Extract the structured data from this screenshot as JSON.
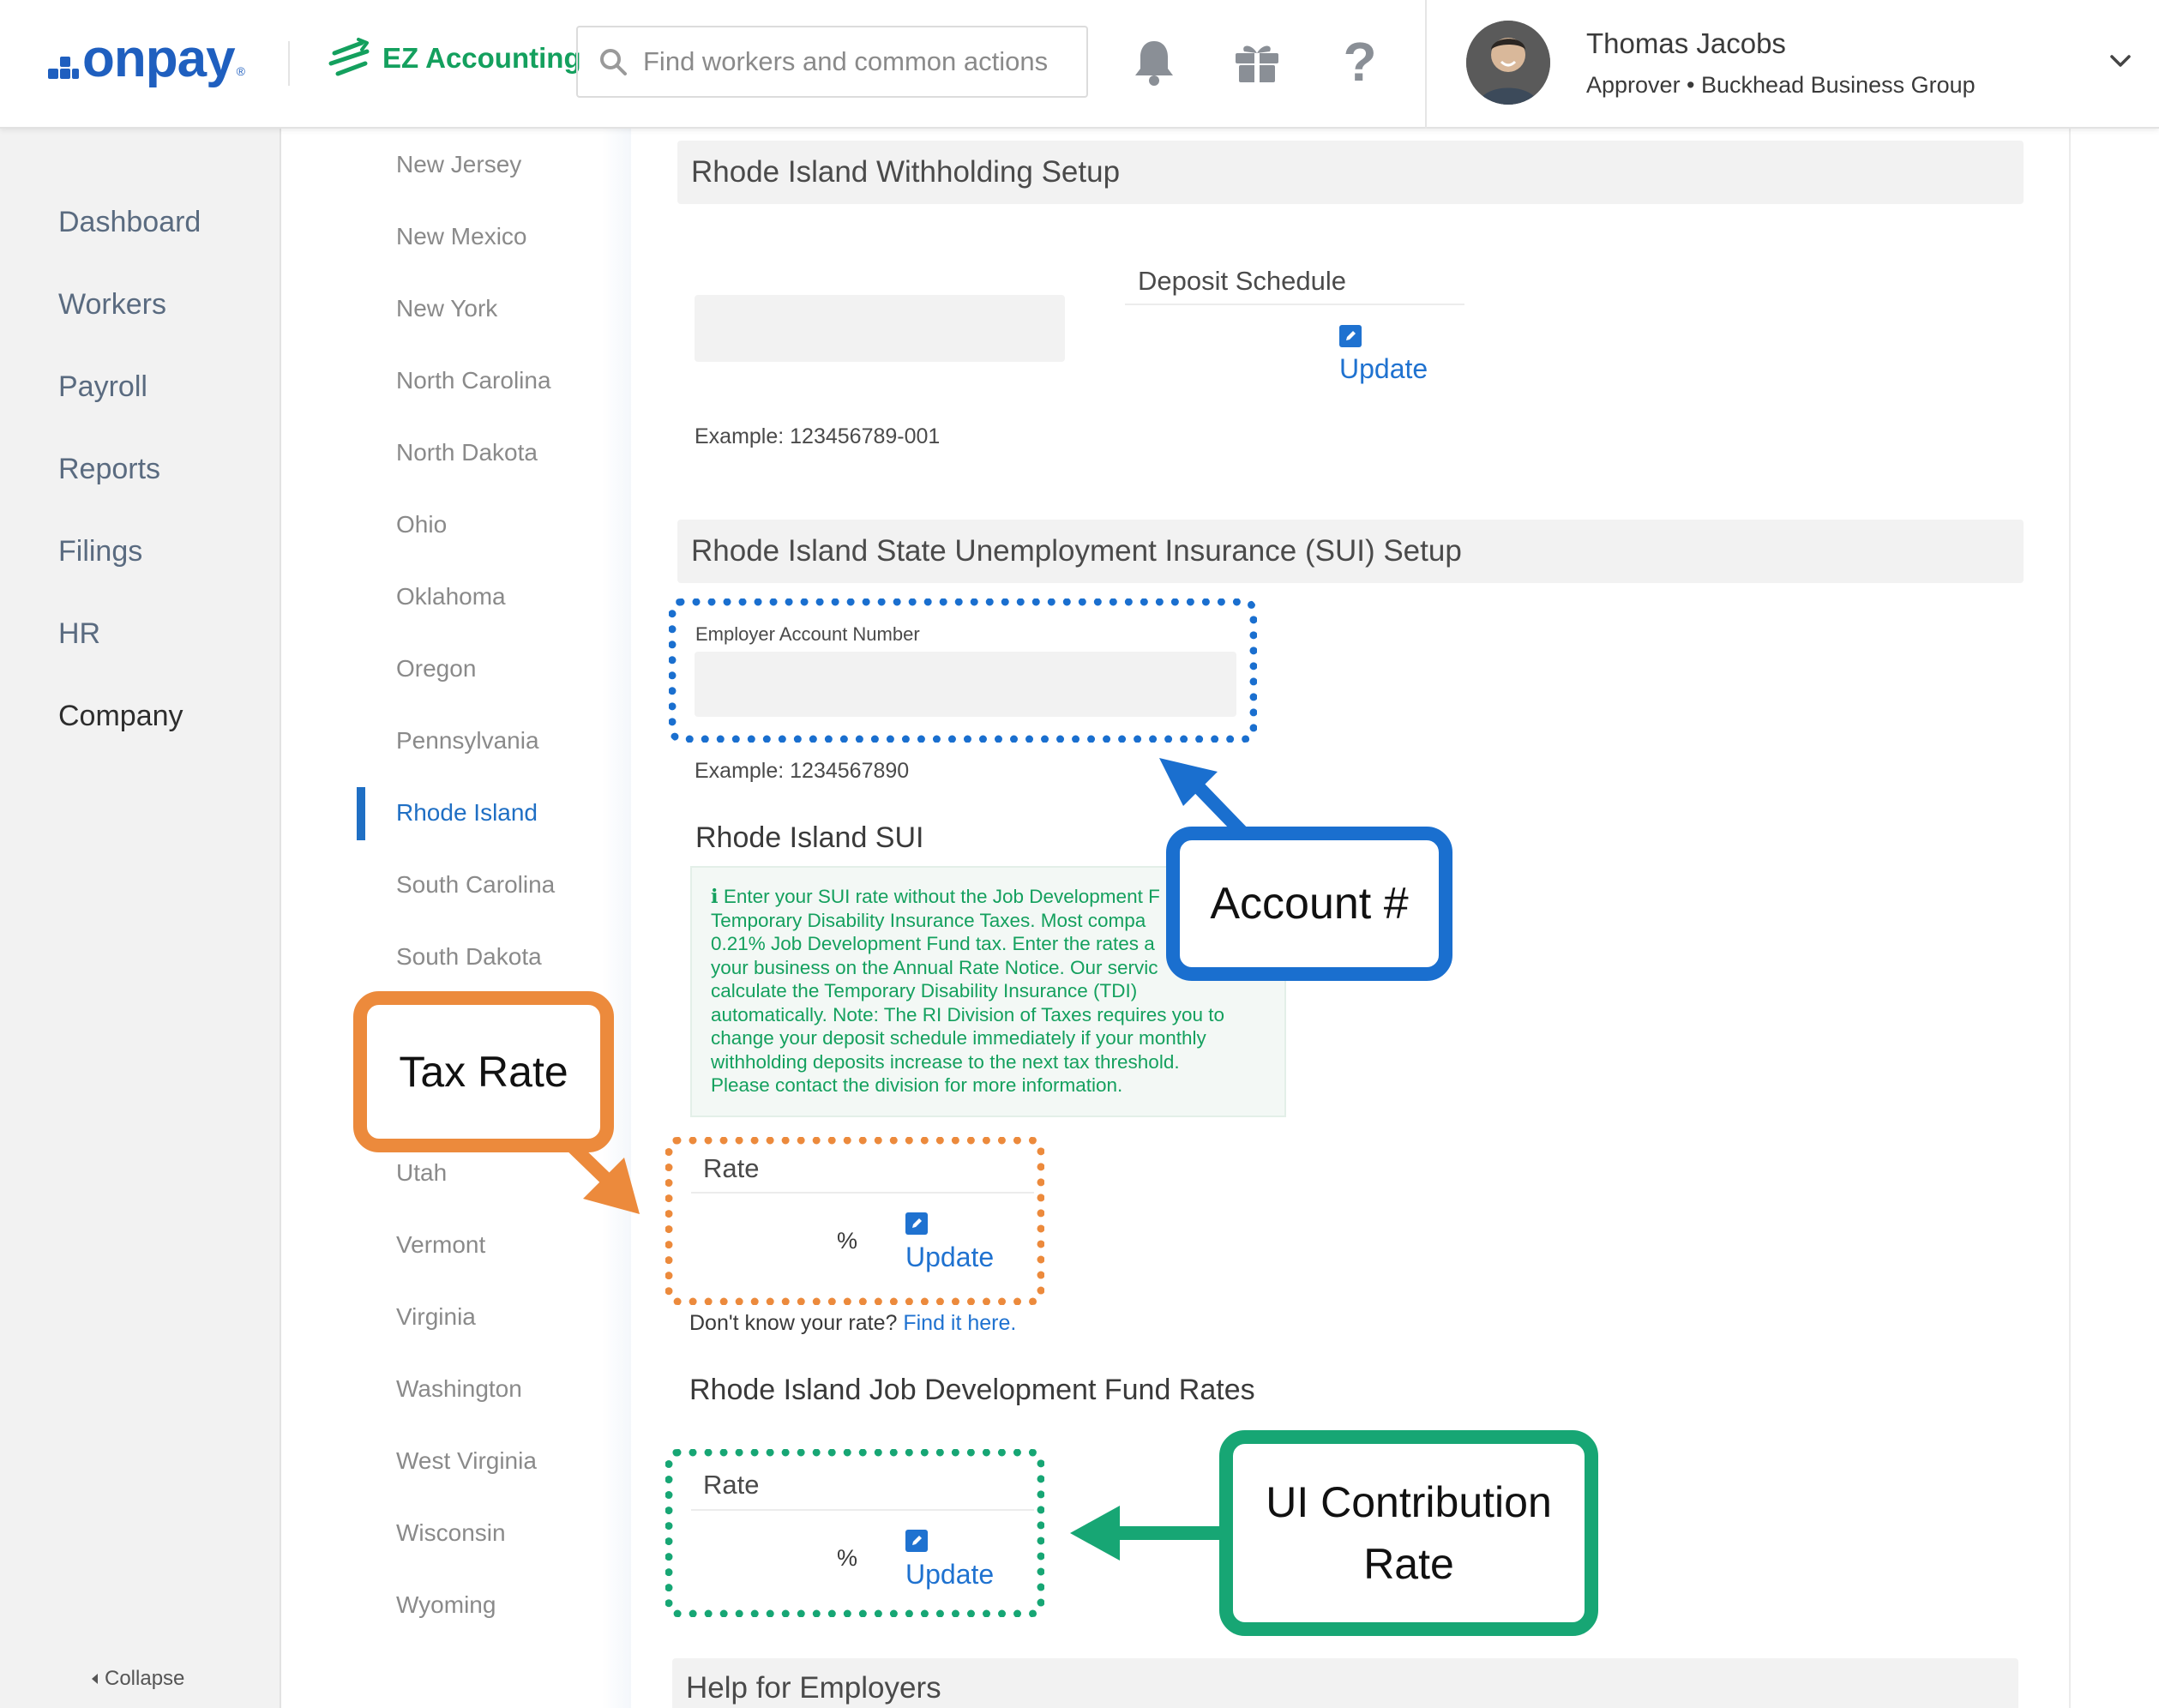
{
  "header": {
    "logo_text": "onpay",
    "ez_label": "EZ Accounting",
    "search_placeholder": "Find workers and common actions",
    "user_name": "Thomas Jacobs",
    "user_role": "Approver • Buckhead Business Group"
  },
  "nav": {
    "items": [
      "Dashboard",
      "Workers",
      "Payroll",
      "Reports",
      "Filings",
      "HR",
      "Company"
    ],
    "active": "Company",
    "collapse_label": "Collapse"
  },
  "states": {
    "items": [
      "New Jersey",
      "New Mexico",
      "New York",
      "North Carolina",
      "North Dakota",
      "Ohio",
      "Oklahoma",
      "Oregon",
      "Pennsylvania",
      "Rhode Island",
      "South Carolina",
      "South Dakota",
      "Utah",
      "Vermont",
      "Virginia",
      "Washington",
      "West Virginia",
      "Wisconsin",
      "Wyoming"
    ],
    "active": "Rhode Island"
  },
  "withholding": {
    "title": "Rhode Island Withholding Setup",
    "deposit_schedule_label": "Deposit Schedule",
    "update_label": "Update",
    "example": "Example: 123456789-001"
  },
  "sui": {
    "title": "Rhode Island State Unemployment Insurance (SUI) Setup",
    "account_label": "Employer Account Number",
    "account_example": "Example: 1234567890",
    "subtitle": "Rhode Island SUI",
    "info_lines": [
      "Enter your SUI rate without the Job Development F",
      "Temporary Disability Insurance Taxes. Most compa",
      "0.21% Job Development Fund tax. Enter the rates a",
      "your business on the Annual Rate Notice. Our servic",
      "calculate the Temporary Disability Insurance (TDI)",
      "automatically. Note: The RI Division of Taxes requires you to",
      "change your deposit schedule immediately if your monthly",
      "withholding deposits increase to the next tax threshold.",
      "Please contact the division for more information."
    ],
    "rate_label": "Rate",
    "percent": "%",
    "update_label": "Update",
    "hint_text": "Don't know your rate? ",
    "hint_link": "Find it here."
  },
  "jdf": {
    "title": "Rhode Island Job Development Fund Rates",
    "rate_label": "Rate",
    "percent": "%",
    "update_label": "Update"
  },
  "help": {
    "title": "Help for Employers"
  },
  "callouts": {
    "account": "Account #",
    "tax_rate": "Tax Rate",
    "ui_line1": "UI Contribution",
    "ui_line2": "Rate"
  },
  "colors": {
    "brand_blue": "#1f5fbf",
    "link_blue": "#1f72d0",
    "ez_green": "#14a05e",
    "callout_blue": "#1a6fcf",
    "callout_orange": "#ec8a3c",
    "callout_green": "#17a674"
  },
  "icons": [
    "search-icon",
    "bell-icon",
    "gift-icon",
    "help-icon",
    "chevron-down-icon",
    "edit-icon",
    "info-icon"
  ]
}
